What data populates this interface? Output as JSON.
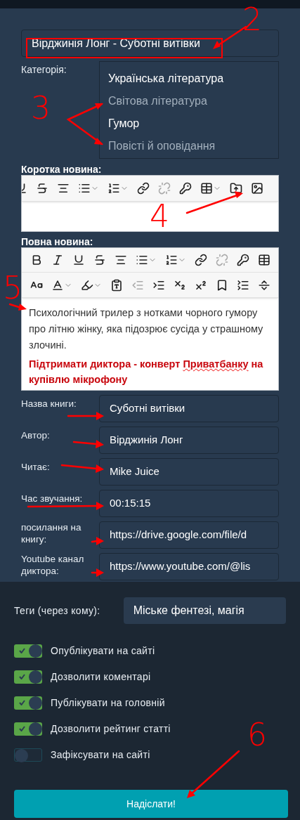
{
  "title_field": {
    "value": "Вірджинія Лонг - Суботні витівки"
  },
  "category": {
    "label": "Категорія:",
    "options": [
      {
        "label": "Українська література",
        "selected": true
      },
      {
        "label": "Світова література",
        "selected": false
      },
      {
        "label": "Гумор",
        "selected": true
      },
      {
        "label": "Повісті й оповідання",
        "selected": false
      }
    ]
  },
  "short_news": {
    "label": "Коротка новина:"
  },
  "full_news": {
    "label": "Повна новина:",
    "paragraph": "Психологічний трилер з нотками чорного гумору про літню жінку, яка підозрює сусіда у страшному злочині.",
    "support_segments": [
      {
        "text": "Підтримати диктора - конверт ",
        "misspelled": false
      },
      {
        "text": "Приватбанку",
        "misspelled": true
      },
      {
        "text": " на купівлю мікрофону",
        "misspelled": false
      }
    ]
  },
  "fields": [
    {
      "label": "Назва книги:",
      "value": "Суботні витівки"
    },
    {
      "label": "Автор:",
      "value": "Вірджинія Лонг"
    },
    {
      "label": "Читає:",
      "value": "Mike Juice"
    },
    {
      "label": "Час звучання:",
      "value": "00:15:15"
    },
    {
      "label": "посилання на книгу:",
      "value": "https://drive.google.com/file/d"
    },
    {
      "label": "Youtube канал диктора:",
      "value": "https://www.youtube.com/@lis"
    }
  ],
  "tags": {
    "label": "Теги (через кому):",
    "value": "Міське фентезі, магія"
  },
  "toggles": [
    {
      "label": "Опублікувати на сайті",
      "on": true
    },
    {
      "label": "Дозволити коментарі",
      "on": true
    },
    {
      "label": "Публікувати на головній",
      "on": true
    },
    {
      "label": "Дозволити рейтинг статті",
      "on": true
    },
    {
      "label": "Зафіксувати на сайті",
      "on": false
    }
  ],
  "submit": {
    "label": "Надіслати!"
  },
  "annotations": [
    "2",
    "3",
    "4",
    "5",
    "6"
  ]
}
